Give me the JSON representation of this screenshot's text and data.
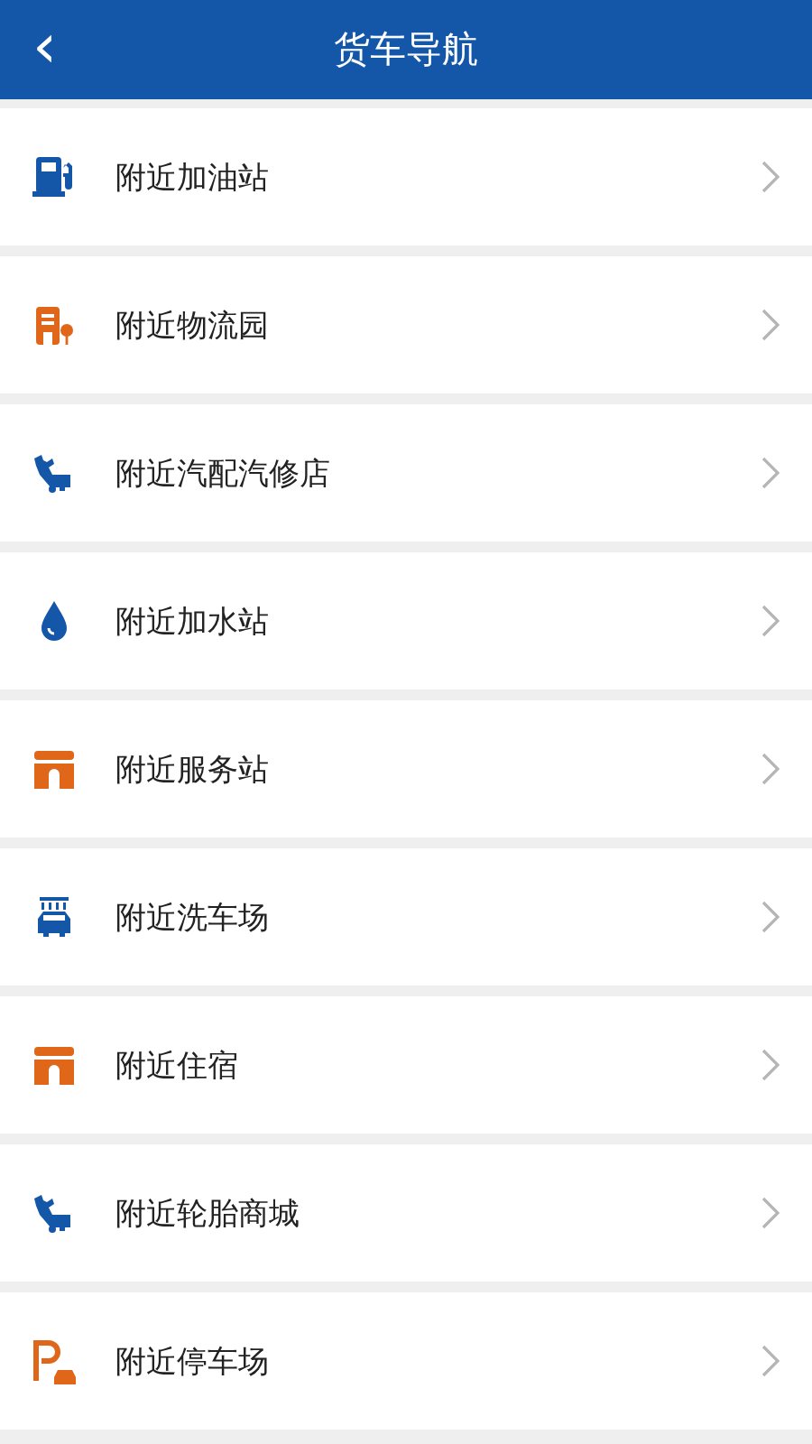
{
  "header": {
    "back": "‹",
    "title": "货车导航"
  },
  "items": [
    {
      "kind": "fuel",
      "label": "附近加油站"
    },
    {
      "kind": "building",
      "label": "附近物流园"
    },
    {
      "kind": "repair",
      "label": "附近汽配汽修店"
    },
    {
      "kind": "water",
      "label": "附近加水站"
    },
    {
      "kind": "arch",
      "label": "附近服务站"
    },
    {
      "kind": "carwash",
      "label": "附近洗车场"
    },
    {
      "kind": "arch",
      "label": "附近住宿"
    },
    {
      "kind": "repair",
      "label": "附近轮胎商城"
    },
    {
      "kind": "parking",
      "label": "附近停车场"
    }
  ]
}
